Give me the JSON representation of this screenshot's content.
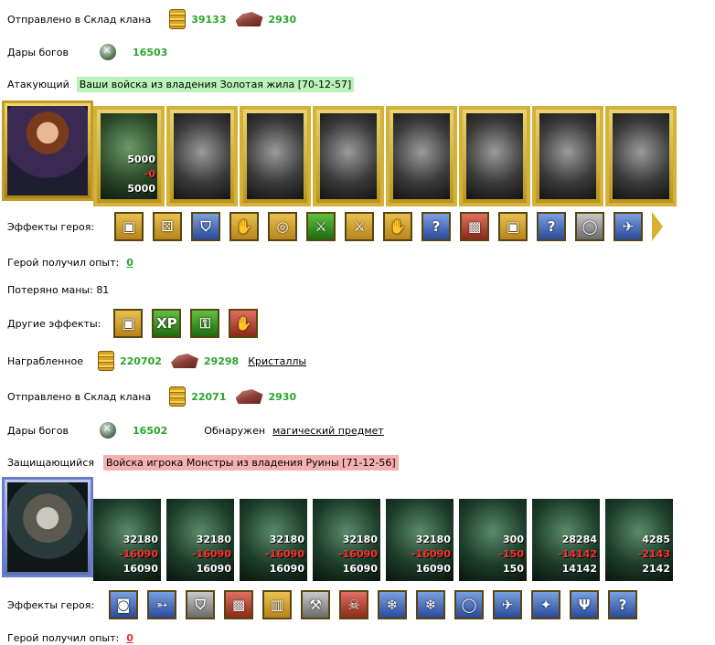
{
  "top": {
    "sent_label": "Отправлено в Склад клана",
    "sent_gold": "39133",
    "sent_ore": "2930",
    "gifts_label": "Дары богов",
    "gifts_value": "16503",
    "attacker_label": "Атакующий",
    "attacker_text": "Ваши войска из владения Золотая жила [70-12-57]"
  },
  "attacker_army": {
    "first_slot": {
      "total": "5000",
      "lost": "-0",
      "remaining": "5000"
    },
    "slot_count": 8
  },
  "attacker_effects": {
    "label": "Эффекты героя:",
    "icons": [
      "chest-icon",
      "dice-icon",
      "shield-icon",
      "hand-shield-icon",
      "coins-icon",
      "sword-icon",
      "sword-shield-icon",
      "magic-hand-icon",
      "question-icon",
      "armor-icon",
      "chest-icon",
      "question-icon",
      "ring-icon",
      "crossbow-icon",
      "arrow-next-icon"
    ],
    "glyphs": [
      "▣",
      "⚄",
      "⛉",
      "✋",
      "◎",
      "⚔",
      "⚔",
      "✋",
      "?",
      "▩",
      "▣",
      "?",
      "◯",
      "✈",
      ""
    ],
    "styles": [
      "",
      "",
      "blue",
      "",
      "",
      "green",
      "",
      "",
      "blue",
      "red",
      "",
      "blue",
      "gray",
      "blue",
      ""
    ]
  },
  "hero_exp": {
    "label": "Герой получил опыт:",
    "value": "0"
  },
  "mana": {
    "label": "Потеряно маны: 81"
  },
  "other_effects": {
    "label": "Другие эффекты:",
    "icons": [
      "gold-chest-icon",
      "xp-icon",
      "puzzle-icon",
      "claw-icon"
    ],
    "glyphs": [
      "▣",
      "XP",
      "⚿",
      "✋"
    ],
    "styles": [
      "",
      "green",
      "green",
      "red"
    ]
  },
  "loot": {
    "label": "Награбленное",
    "gold": "220702",
    "ore": "29298",
    "crystals": "Кристаллы"
  },
  "sent2": {
    "label": "Отправлено в Склад клана",
    "gold": "22071",
    "ore": "2930"
  },
  "gifts2": {
    "label": "Дары богов",
    "value": "16502",
    "found_label": "Обнаружен",
    "found_link": "магический предмет"
  },
  "defender": {
    "label": "Защищающийся",
    "text": "Войска игрока Монстры из владения Руины [71-12-56]"
  },
  "defender_army": [
    {
      "total": "32180",
      "lost": "-16090",
      "remaining": "16090"
    },
    {
      "total": "32180",
      "lost": "-16090",
      "remaining": "16090"
    },
    {
      "total": "32180",
      "lost": "-16090",
      "remaining": "16090"
    },
    {
      "total": "32180",
      "lost": "-16090",
      "remaining": "16090"
    },
    {
      "total": "32180",
      "lost": "-16090",
      "remaining": "16090"
    },
    {
      "total": "300",
      "lost": "-150",
      "remaining": "150"
    },
    {
      "total": "28284",
      "lost": "-14142",
      "remaining": "14142"
    },
    {
      "total": "4285",
      "lost": "-2143",
      "remaining": "2142"
    }
  ],
  "defender_effects": {
    "label": "Эффекты героя:",
    "icons": [
      "helmet-icon",
      "arrows-icon",
      "shield-icon",
      "armor-icon",
      "totem-icon",
      "hammer-icon",
      "skull-icon",
      "ice-icon",
      "frost-armor-icon",
      "frost-ring-icon",
      "crossbow-icon",
      "wand-icon",
      "trident-icon",
      "question-icon"
    ],
    "glyphs": [
      "◙",
      "➳",
      "⛉",
      "▩",
      "▥",
      "⚒",
      "☠",
      "❄",
      "❄",
      "◯",
      "✈",
      "✦",
      "Ψ",
      "?"
    ],
    "styles": [
      "blue",
      "blue",
      "gray",
      "red",
      "",
      "gray",
      "red",
      "blue",
      "blue",
      "blue",
      "blue",
      "blue",
      "blue",
      "blue"
    ]
  },
  "def_exp": {
    "label": "Герой получил опыт:",
    "value": "0"
  }
}
